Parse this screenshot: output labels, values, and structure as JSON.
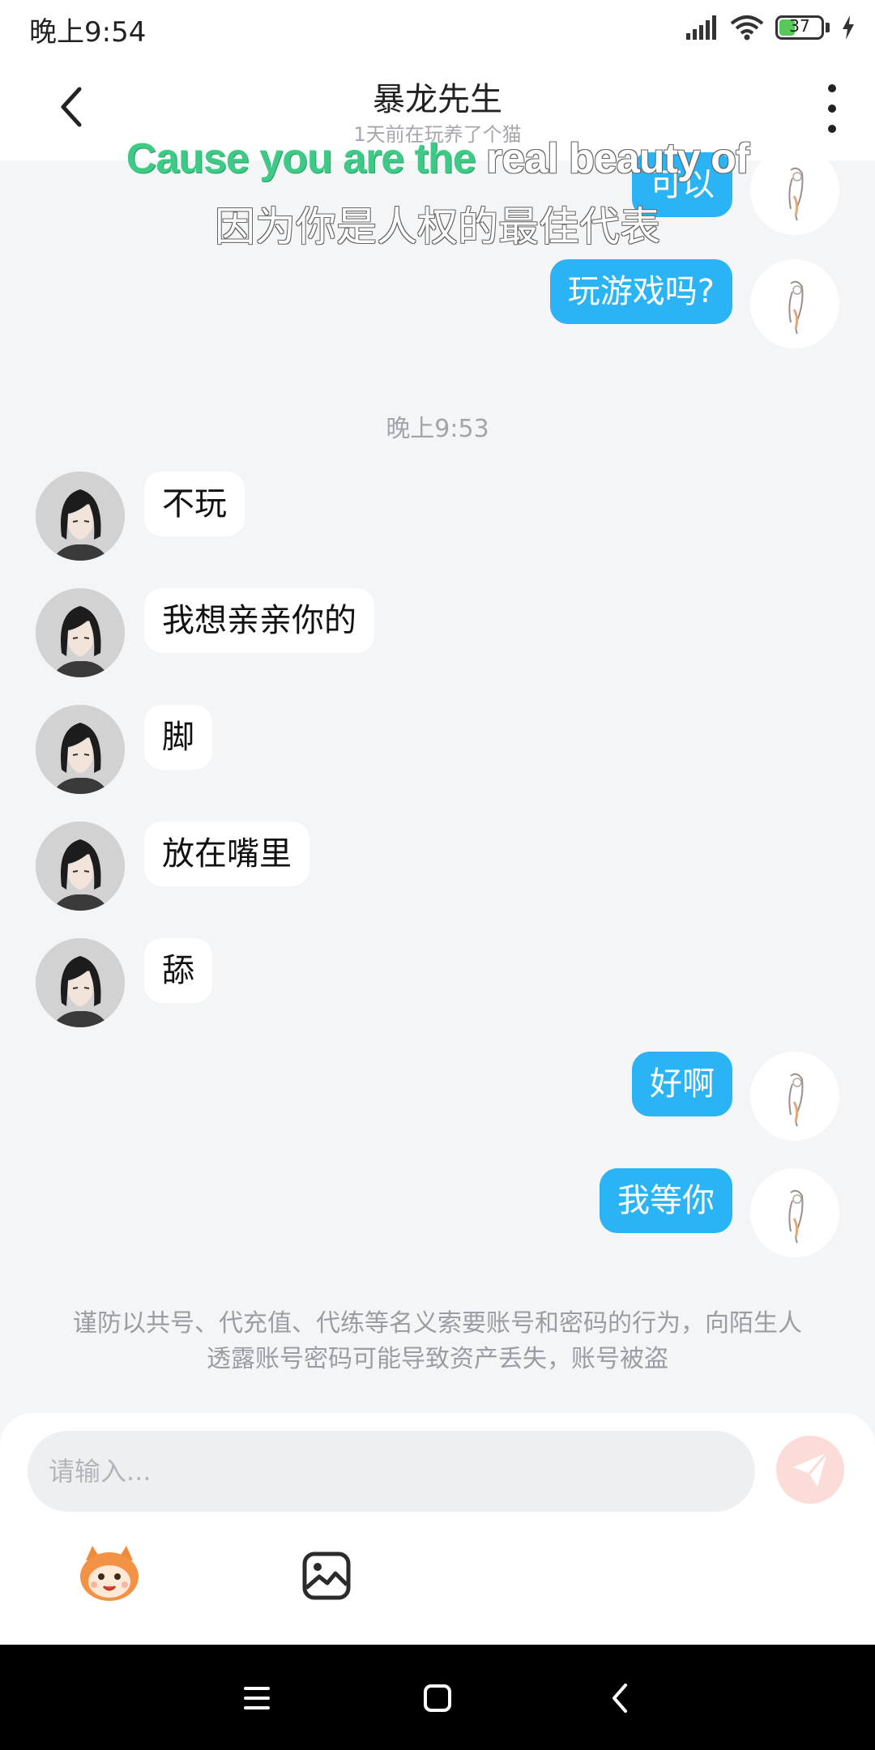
{
  "status_bar": {
    "time": "晚上9:54",
    "battery_level": 37,
    "battery_text": "37",
    "icons": [
      "signal-icon",
      "wifi-icon",
      "battery-icon",
      "charging-icon"
    ]
  },
  "header": {
    "title": "暴龙先生",
    "subtitle": "1天前在玩养了个猫"
  },
  "lyrics": {
    "en_sung": "Cause you are the",
    "en_rest": " real beauty of",
    "cn": "因为你是人权的最佳代表"
  },
  "messages": [
    {
      "side": "right",
      "text": "可以"
    },
    {
      "side": "right",
      "text": "玩游戏吗?"
    },
    {
      "type": "time",
      "text": "晚上9:53"
    },
    {
      "side": "left",
      "text": "不玩"
    },
    {
      "side": "left",
      "text": "我想亲亲你的"
    },
    {
      "side": "left",
      "text": "脚"
    },
    {
      "side": "left",
      "text": "放在嘴里"
    },
    {
      "side": "left",
      "text": "舔"
    },
    {
      "side": "right",
      "text": "好啊"
    },
    {
      "side": "right",
      "text": "我等你"
    }
  ],
  "warning": "谨防以共号、代充值、代练等名义索要账号和密码的行为，向陌生人透露账号密码可能导致资产丢失，账号被盗",
  "composer": {
    "placeholder": "请输入...",
    "value": ""
  },
  "colors": {
    "accent": "#2ab4f5",
    "bubble_left": "#ffffff",
    "background": "#f4f5f7",
    "send_disabled": "#fcdcd9",
    "battery": "#58c85a"
  }
}
